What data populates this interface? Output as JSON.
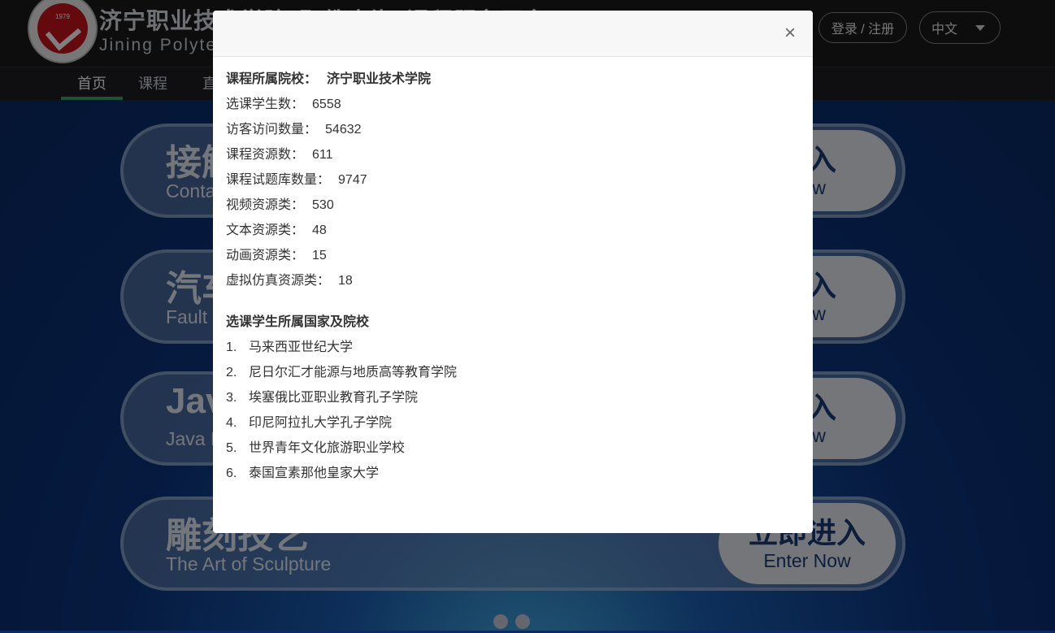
{
  "header": {
    "title": "济宁职业技术学院“职教出海”课程服务平台",
    "subtitle": "Jining Polytechnic",
    "logo_text": "JINING POLYTECHNIC",
    "logo_year": "1979",
    "login_label": "登录 / 注册",
    "language": "中文"
  },
  "nav": {
    "items": [
      {
        "label": "首页",
        "active": true
      },
      {
        "label": "课程",
        "active": false
      },
      {
        "label": "直",
        "active": false
      }
    ]
  },
  "cards": [
    {
      "zh": "接触",
      "en": "Conta",
      "enter_zh": "进入",
      "enter_en": "Now"
    },
    {
      "zh": "汽车",
      "en": "Fault",
      "enter_zh": "进入",
      "enter_en": "Now"
    },
    {
      "zh": "Java",
      "en": "Java P",
      "enter_zh": "进入",
      "enter_en": "Now"
    },
    {
      "zh": "雕刻技艺",
      "en": "The Art of Sculpture",
      "enter_zh": "立即进入",
      "enter_en": "Enter Now"
    }
  ],
  "modal": {
    "close_symbol": "×",
    "school_label": "课程所属院校：",
    "school_value": "济宁职业技术学院",
    "stats": [
      {
        "label": "选课学生数：",
        "value": "6558"
      },
      {
        "label": "访客访问数量：",
        "value": "54632"
      },
      {
        "label": "课程资源数：",
        "value": "611"
      },
      {
        "label": "课程试题库数量：",
        "value": "9747"
      },
      {
        "label": "视频资源类：",
        "value": "530"
      },
      {
        "label": "文本资源类：",
        "value": "48"
      },
      {
        "label": "动画资源类：",
        "value": "15"
      },
      {
        "label": "虚拟仿真资源类：",
        "value": "18"
      }
    ],
    "section_title": "选课学生所属国家及院校",
    "institutions": [
      {
        "num": "1.",
        "name": "马来西亚世纪大学"
      },
      {
        "num": "2.",
        "name": "尼日尔汇才能源与地质高等教育学院"
      },
      {
        "num": "3.",
        "name": "埃塞俄比亚职业教育孔子学院"
      },
      {
        "num": "4.",
        "name": "印尼阿拉扎大学孔子学院"
      },
      {
        "num": "5.",
        "name": "世界青年文化旅游职业学校"
      },
      {
        "num": "6.",
        "name": "泰国宣素那他皇家大学"
      }
    ]
  }
}
